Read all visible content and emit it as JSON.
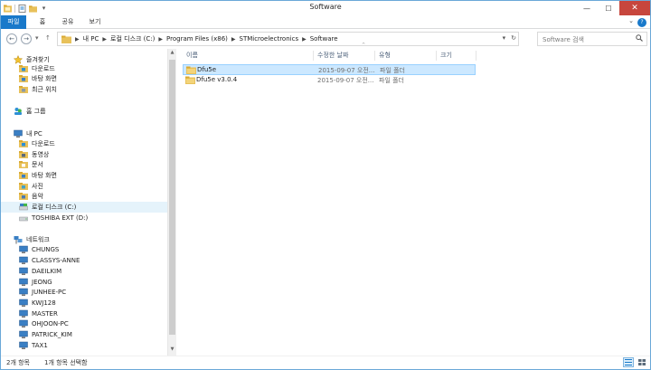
{
  "window": {
    "title": "Software",
    "controls": {
      "minimize": "—",
      "maximize": "☐",
      "close": "✕"
    }
  },
  "quick_access": {
    "dropdown": "▾"
  },
  "ribbon": {
    "tabs": [
      "파일",
      "홈",
      "공유",
      "보기"
    ],
    "collapse": "⌄",
    "help": "?"
  },
  "navigation": {
    "back": "←",
    "forward": "→",
    "history": "▾",
    "up": "↑",
    "breadcrumb": [
      "내 PC",
      "로컬 디스크 (C:)",
      "Program Files (x86)",
      "STMicroelectronics",
      "Software"
    ],
    "address_dropdown": "▾",
    "refresh": "↻",
    "search_placeholder": "Software 검색"
  },
  "sidebar": {
    "items": [
      {
        "label": "즐겨찾기",
        "icon": "star-icon",
        "indent": 0
      },
      {
        "label": "다운로드",
        "icon": "download-folder-icon",
        "indent": 1
      },
      {
        "label": "바탕 화면",
        "icon": "desktop-icon",
        "indent": 1
      },
      {
        "label": "최근 위치",
        "icon": "recent-places-icon",
        "indent": 1
      },
      {
        "label": "홈 그룹",
        "icon": "homegroup-icon",
        "indent": 0
      },
      {
        "label": "내 PC",
        "icon": "computer-icon",
        "indent": 0
      },
      {
        "label": "다운로드",
        "icon": "download-folder-icon",
        "indent": 1
      },
      {
        "label": "동영상",
        "icon": "videos-folder-icon",
        "indent": 1
      },
      {
        "label": "문서",
        "icon": "documents-folder-icon",
        "indent": 1
      },
      {
        "label": "바탕 화면",
        "icon": "desktop-icon",
        "indent": 1
      },
      {
        "label": "사진",
        "icon": "pictures-folder-icon",
        "indent": 1
      },
      {
        "label": "음악",
        "icon": "music-folder-icon",
        "indent": 1
      },
      {
        "label": "로컬 디스크 (C:)",
        "icon": "local-disk-icon",
        "indent": 1,
        "selected": true
      },
      {
        "label": "TOSHIBA EXT (D:)",
        "icon": "external-drive-icon",
        "indent": 1
      },
      {
        "label": "네트워크",
        "icon": "network-icon",
        "indent": 0
      },
      {
        "label": "CHUNGS",
        "icon": "network-computer-icon",
        "indent": 1
      },
      {
        "label": "CLASSYS-ANNE",
        "icon": "network-computer-icon",
        "indent": 1
      },
      {
        "label": "DAEILKIM",
        "icon": "network-computer-icon",
        "indent": 1
      },
      {
        "label": "JEONG",
        "icon": "network-computer-icon",
        "indent": 1
      },
      {
        "label": "JUNHEE-PC",
        "icon": "network-computer-icon",
        "indent": 1
      },
      {
        "label": "KWJ128",
        "icon": "network-computer-icon",
        "indent": 1
      },
      {
        "label": "MASTER",
        "icon": "network-computer-icon",
        "indent": 1
      },
      {
        "label": "OHJOON-PC",
        "icon": "network-computer-icon",
        "indent": 1
      },
      {
        "label": "PATRICK_KIM",
        "icon": "network-computer-icon",
        "indent": 1
      },
      {
        "label": "TAX1",
        "icon": "network-computer-icon",
        "indent": 1
      }
    ],
    "scroll_up": "▲",
    "scroll_down": "▼"
  },
  "file_list": {
    "columns": [
      "이름",
      "수정한 날짜",
      "유형",
      "크기"
    ],
    "sort_indicator": "^",
    "rows": [
      {
        "name": "Dfu5e",
        "modified": "2015-09-07 오전...",
        "type": "파일 폴더",
        "size": "",
        "selected": true
      },
      {
        "name": "Dfu5e v3.0.4",
        "modified": "2015-09-07 오전...",
        "type": "파일 폴더",
        "size": "",
        "selected": false
      }
    ]
  },
  "status_bar": {
    "item_count": "2개 항목",
    "selection": "1개 항목 선택함"
  },
  "colors": {
    "accent": "#1979ca",
    "close_button": "#c7463d",
    "selection_fill": "#cce8ff",
    "selection_border": "#99d1ff",
    "folder": "#e8c15a"
  }
}
